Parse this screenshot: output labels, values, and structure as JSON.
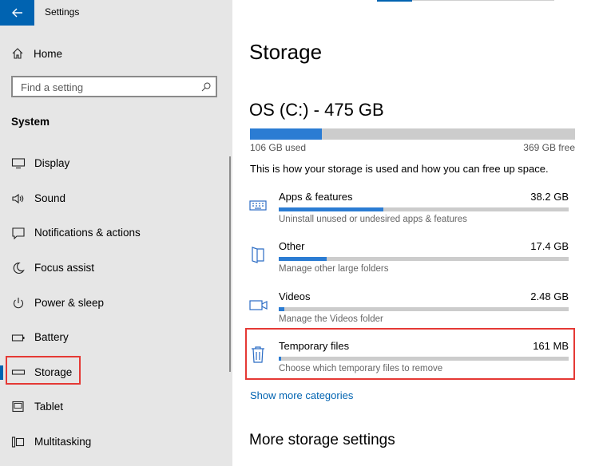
{
  "window": {
    "title": "Settings"
  },
  "sidebar": {
    "home_label": "Home",
    "search_placeholder": "Find a setting",
    "section": "System",
    "items": [
      {
        "label": "Display",
        "icon": "monitor-icon"
      },
      {
        "label": "Sound",
        "icon": "speaker-icon"
      },
      {
        "label": "Notifications & actions",
        "icon": "notification-icon"
      },
      {
        "label": "Focus assist",
        "icon": "moon-icon"
      },
      {
        "label": "Power & sleep",
        "icon": "power-icon"
      },
      {
        "label": "Battery",
        "icon": "battery-icon"
      },
      {
        "label": "Storage",
        "icon": "storage-icon",
        "active": true
      },
      {
        "label": "Tablet",
        "icon": "tablet-icon"
      },
      {
        "label": "Multitasking",
        "icon": "multitasking-icon"
      }
    ]
  },
  "main": {
    "title": "Storage",
    "drive": {
      "name": "OS (C:) - 475 GB",
      "used_label": "106 GB used",
      "free_label": "369 GB free",
      "used_fraction": 0.22
    },
    "description": "This is how your storage is used and how you can free up space.",
    "categories": [
      {
        "name": "Apps & features",
        "size": "38.2 GB",
        "sub": "Uninstall unused or undesired apps & features",
        "fraction": 0.36,
        "icon": "keyboard-icon"
      },
      {
        "name": "Other",
        "size": "17.4 GB",
        "sub": "Manage other large folders",
        "fraction": 0.165,
        "icon": "folder-icon"
      },
      {
        "name": "Videos",
        "size": "2.48 GB",
        "sub": "Manage the Videos folder",
        "fraction": 0.02,
        "icon": "video-icon"
      },
      {
        "name": "Temporary files",
        "size": "161 MB",
        "sub": "Choose which temporary files to remove",
        "fraction": 0.002,
        "icon": "trash-icon"
      }
    ],
    "show_more": "Show more categories",
    "more_settings_title": "More storage settings"
  },
  "colors": {
    "accent": "#0063b1",
    "bar_fill": "#2b7cd3",
    "highlight": "#e53935"
  }
}
